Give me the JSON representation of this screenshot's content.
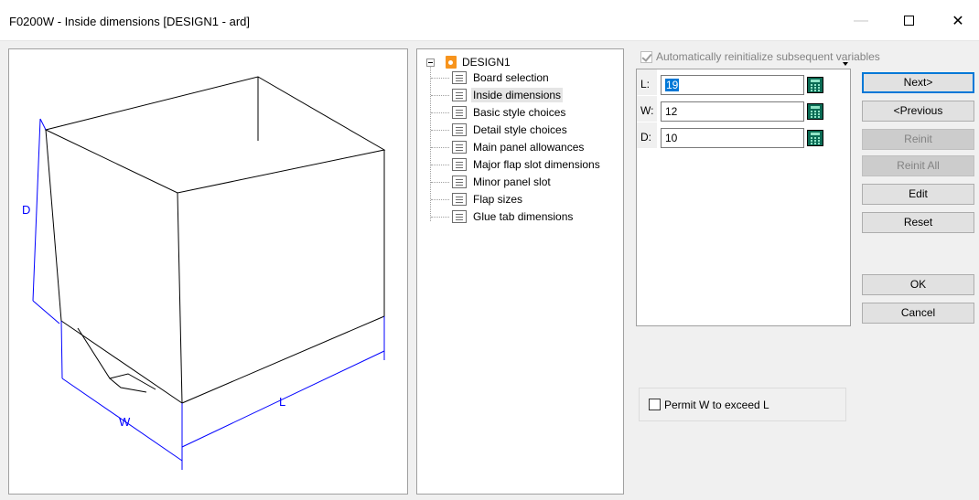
{
  "window": {
    "title": "F0200W - Inside dimensions [DESIGN1 - ard]",
    "minimize_glyph": "—",
    "maximize_icon": "maximize-icon",
    "close_glyph": "✕"
  },
  "preview": {
    "dim_labels": {
      "d": "D",
      "w": "W",
      "l": "L"
    },
    "line_color": "#0000ff"
  },
  "tree": {
    "root_label": "DESIGN1",
    "items": [
      {
        "label": "Board selection"
      },
      {
        "label": "Inside dimensions",
        "selected": true
      },
      {
        "label": "Basic style choices"
      },
      {
        "label": "Detail style choices"
      },
      {
        "label": "Main panel allowances"
      },
      {
        "label": "Major flap slot dimensions"
      },
      {
        "label": "Minor panel slot"
      },
      {
        "label": "Flap sizes"
      },
      {
        "label": "Glue tab dimensions"
      }
    ]
  },
  "options": {
    "auto_reinit_label": "Automatically reinitialize subsequent variables",
    "auto_reinit_checked": true,
    "permit_label": "Permit W to exceed L",
    "permit_checked": false
  },
  "variables": [
    {
      "name": "L:",
      "value": "19"
    },
    {
      "name": "W:",
      "value": "12"
    },
    {
      "name": "D:",
      "value": "10"
    }
  ],
  "buttons": {
    "next": "Next>",
    "previous": "<Previous",
    "reinit": "Reinit",
    "reinit_all": "Reinit All",
    "edit": "Edit",
    "reset": "Reset",
    "ok": "OK",
    "cancel": "Cancel"
  },
  "colors": {
    "accent": "#0078d7",
    "root_icon": "#f7941d",
    "calc_icon": "#0a6b54"
  }
}
